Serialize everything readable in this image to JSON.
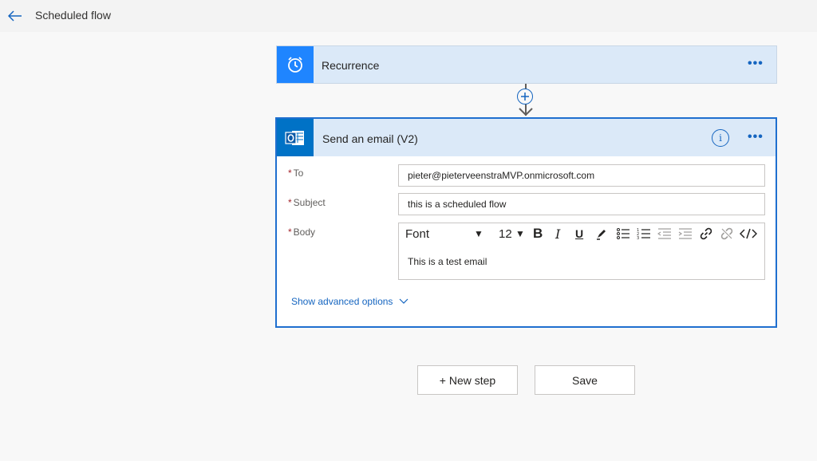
{
  "header": {
    "title": "Scheduled flow"
  },
  "recurrence": {
    "title": "Recurrence",
    "more": "•••"
  },
  "email_action": {
    "title": "Send an email (V2)",
    "more": "•••",
    "fields": {
      "to": {
        "label": "To",
        "value": "pieter@pieterveenstraMVP.onmicrosoft.com"
      },
      "subject": {
        "label": "Subject",
        "value": "this is a scheduled flow"
      },
      "body": {
        "label": "Body",
        "value": "This is a test email"
      }
    },
    "toolbar": {
      "font": "Font",
      "size": "12"
    },
    "advanced": "Show advanced options"
  },
  "buttons": {
    "new_step": "+ New step",
    "save": "Save"
  },
  "colors": {
    "accent": "#1565c0",
    "card_header": "#dbe9f8",
    "recurrence_icon_bg": "#1f85ff",
    "outlook_icon_bg": "#0072c6"
  }
}
